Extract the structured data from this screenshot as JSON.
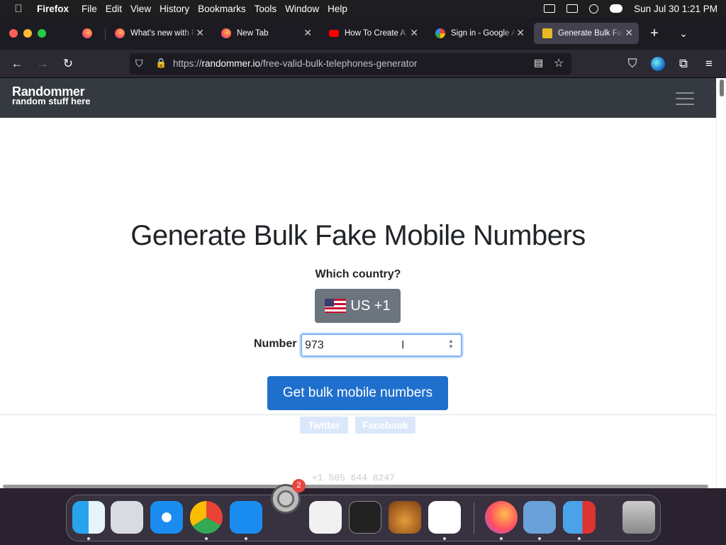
{
  "menubar": {
    "app": "Firefox",
    "items": [
      "File",
      "Edit",
      "View",
      "History",
      "Bookmarks",
      "Tools",
      "Window",
      "Help"
    ],
    "clock": "Sun Jul 30  1:21 PM"
  },
  "tabs": [
    {
      "label": "What's new with Firefox",
      "icon": "firefox-icon",
      "active": false
    },
    {
      "label": "New Tab",
      "icon": "firefox-icon",
      "active": false
    },
    {
      "label": "How To Create A",
      "icon": "youtube-icon",
      "active": false
    },
    {
      "label": "Sign in - Google Accounts",
      "icon": "google-icon",
      "active": false
    },
    {
      "label": "Generate Bulk Fake",
      "icon": "randommer-icon",
      "active": true
    }
  ],
  "urlbar": {
    "prefix": "https://",
    "domain": "randommer.io",
    "path": "/free-valid-bulk-telephones-generator"
  },
  "site": {
    "brand_title": "Randommer",
    "brand_tagline": "random stuff here",
    "headline": "Generate Bulk Fake Mobile Numbers",
    "country_label": "Which country?",
    "country_value": "US +1",
    "number_label": "Number",
    "number_value": "973",
    "submit_label": "Get bulk mobile numbers",
    "share_twitter": "Twitter",
    "share_facebook": "Facebook",
    "faint_result": "+1 505 644 8247"
  },
  "dock": {
    "badge_count": "2"
  },
  "colors": {
    "primary": "#1f6fcc",
    "navbar": "#343a40",
    "secondary": "#6c757d"
  }
}
